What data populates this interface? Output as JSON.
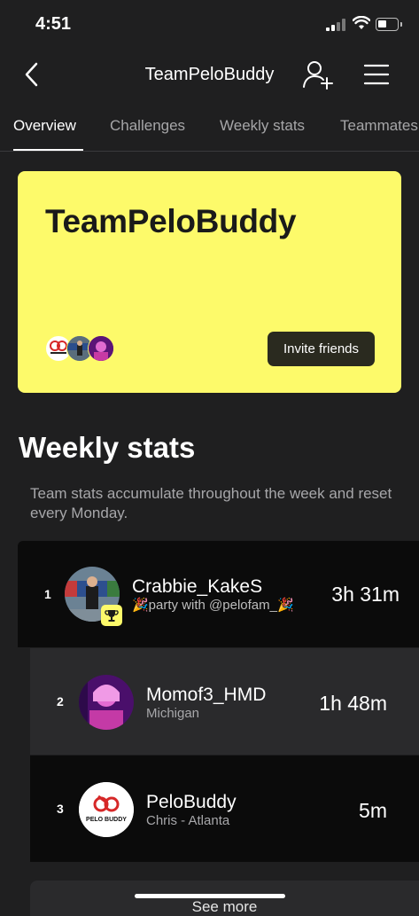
{
  "status_bar": {
    "time": "4:51"
  },
  "nav": {
    "title": "TeamPeloBuddy"
  },
  "tabs": [
    {
      "label": "Overview",
      "active": true
    },
    {
      "label": "Challenges",
      "active": false
    },
    {
      "label": "Weekly stats",
      "active": false
    },
    {
      "label": "Teammates",
      "active": false
    }
  ],
  "hero": {
    "title": "TeamPeloBuddy",
    "invite_label": "Invite friends",
    "background": "#fdfa6a"
  },
  "weekly": {
    "title": "Weekly stats",
    "description": "Team stats accumulate throughout the week and reset every Monday."
  },
  "leaderboard": [
    {
      "rank": "1",
      "name": "Crabbie_KakeS",
      "sub": "🎉party with @pelofam_🎉",
      "time": "3h 31m",
      "trophy": true
    },
    {
      "rank": "2",
      "name": "Momof3_HMD",
      "sub": "Michigan",
      "time": "1h 48m",
      "trophy": false
    },
    {
      "rank": "3",
      "name": "PeloBuddy",
      "sub": "Chris - Atlanta",
      "time": "5m",
      "trophy": false
    }
  ],
  "avatar_logo_text": "PELO BUDDY",
  "see_more_label": "See more",
  "colors": {
    "accent_yellow": "#fdfa6a",
    "background": "#1f1f20",
    "row_dark": "#0b0b0b",
    "row_mid": "#2a2a2c"
  }
}
